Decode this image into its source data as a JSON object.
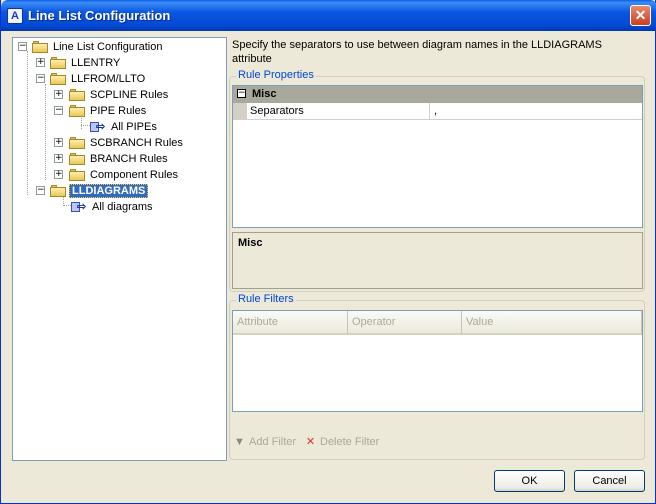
{
  "window": {
    "title": "Line List Configuration",
    "app_icon": "A",
    "close_label": "✕"
  },
  "tree": {
    "root": "Line List Configuration",
    "llentry": "LLENTRY",
    "llfrom": "LLFROM/LLTO",
    "scpline": "SCPLINE Rules",
    "pipe": "PIPE Rules",
    "all_pipes": "All PIPEs",
    "scbranch": "SCBRANCH Rules",
    "branch": "BRANCH Rules",
    "component": "Component Rules",
    "lldiagrams": "LLDIAGRAMS",
    "all_diagrams": "All diagrams"
  },
  "description": "Specify the separators to use between diagram names in the LLDIAGRAMS attribute",
  "rule_properties": {
    "title": "Rule Properties",
    "category": "Misc",
    "property_name": "Separators",
    "property_value": ",",
    "help_title": "Misc"
  },
  "rule_filters": {
    "title": "Rule Filters",
    "columns": [
      "Attribute",
      "Operator",
      "Value"
    ],
    "add_label": "Add Filter",
    "delete_label": "Delete Filter"
  },
  "buttons": {
    "ok": "OK",
    "cancel": "Cancel"
  },
  "icons": {
    "folder": "folder-icon",
    "rule": "rule-icon",
    "funnel": "funnel-icon",
    "delete": "delete-x-icon"
  }
}
